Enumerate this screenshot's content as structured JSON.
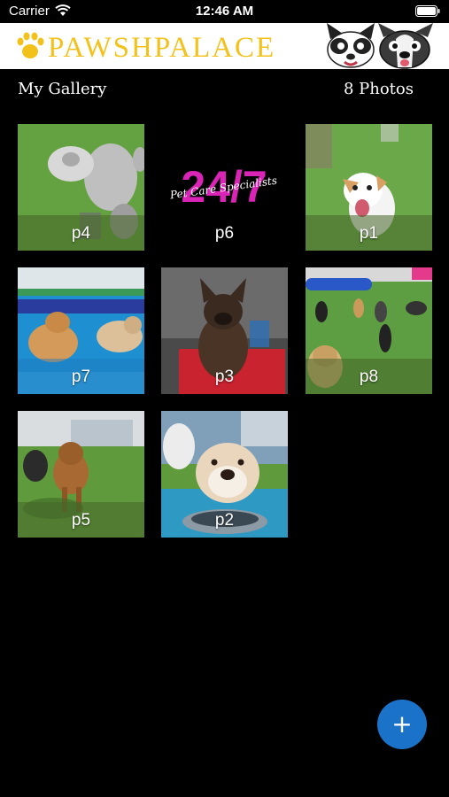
{
  "status_bar": {
    "carrier": "Carrier",
    "time": "12:46 AM",
    "wifi_icon": "wifi-icon",
    "battery_icon": "battery-icon"
  },
  "banner": {
    "logo_text": "PAWSHPALACE",
    "logo_icon": "paw-icon",
    "image": "dogs-illustration"
  },
  "header": {
    "title": "My Gallery",
    "count": "8 Photos"
  },
  "gallery": {
    "photos": [
      {
        "label": "p4"
      },
      {
        "label": "p6",
        "text": "24/7",
        "subtext": "Pet Care Specialists"
      },
      {
        "label": "p1"
      },
      {
        "label": "p7"
      },
      {
        "label": "p3"
      },
      {
        "label": "p8"
      },
      {
        "label": "p5"
      },
      {
        "label": "p2"
      }
    ]
  },
  "fab": {
    "label": "+",
    "icon": "plus-icon"
  },
  "colors": {
    "background": "#000000",
    "accent": "#1a73c9",
    "neon": "#ff2bd6"
  }
}
